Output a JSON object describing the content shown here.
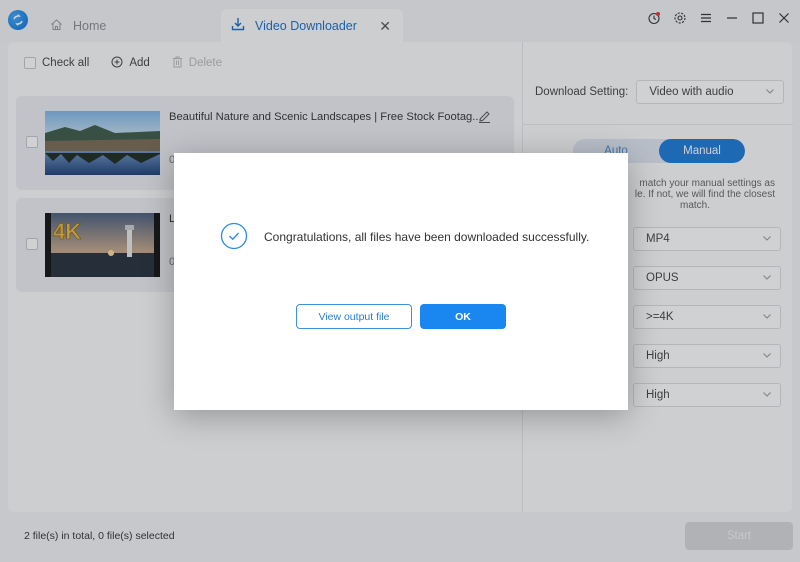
{
  "titlebar": {
    "tabs": [
      {
        "label": "Home",
        "icon": "home-icon",
        "active": false
      },
      {
        "label": "Video Downloader",
        "icon": "download-icon",
        "active": true
      }
    ],
    "window_controls": [
      "history-icon",
      "gear-icon",
      "menu-icon",
      "minimize-icon",
      "maximize-icon",
      "close-icon"
    ]
  },
  "toolbar": {
    "check_all": "Check all",
    "add": "Add",
    "delete": "Delete"
  },
  "files": [
    {
      "title": "Beautiful Nature and Scenic Landscapes | Free Stock Footag...",
      "sub": "0",
      "thumb": "lake-landscape"
    },
    {
      "title": "L",
      "sub": "0",
      "thumb": "4k-lighthouse",
      "thumb_badge": "4K"
    }
  ],
  "settings": {
    "download_setting_label": "Download Setting:",
    "download_setting_value": "Video with audio",
    "mode_options": [
      "Auto",
      "Manual"
    ],
    "mode_selected": "Manual",
    "hint": "match your manual settings as\nle. If not, we will find the closest\nmatch.",
    "hint_lines": [
      "match your manual settings as",
      "le. If not, we will find the closest",
      "match."
    ],
    "options": [
      {
        "value": "MP4"
      },
      {
        "value": "OPUS"
      },
      {
        "value": ">=4K"
      },
      {
        "value": "High"
      },
      {
        "value": "High"
      }
    ]
  },
  "footer": {
    "status": "2 file(s) in total, 0 file(s) selected",
    "start": "Start"
  },
  "dialog": {
    "message": "Congratulations, all files have been downloaded successfully.",
    "view_output": "View output file",
    "ok": "OK"
  },
  "colors": {
    "accent": "#1a87f0",
    "tab_active_text": "#1c6fc7",
    "toggle_active": "#1c7ad9"
  }
}
